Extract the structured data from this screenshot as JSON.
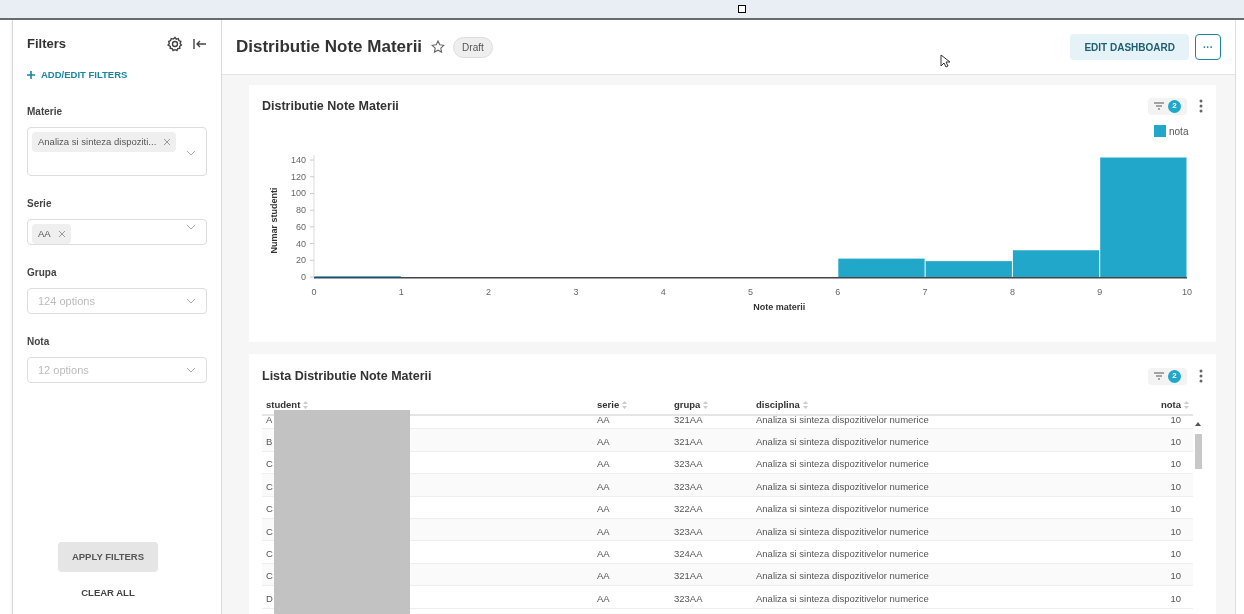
{
  "sidebar": {
    "title": "Filters",
    "add_filters": "ADD/EDIT FILTERS",
    "filters": [
      {
        "kind": "tags",
        "label": "Materie",
        "tags": [
          "Analiza si sinteza dispoziti..."
        ]
      },
      {
        "kind": "tags",
        "label": "Serie",
        "tags": [
          "AA"
        ]
      },
      {
        "kind": "empty",
        "label": "Grupa",
        "placeholder": "124 options"
      },
      {
        "kind": "empty",
        "label": "Nota",
        "placeholder": "12 options"
      }
    ],
    "apply_button": "APPLY FILTERS",
    "clear_button": "CLEAR ALL"
  },
  "header": {
    "title": "Distributie Note Materii",
    "starred": false,
    "badge": "Draft",
    "edit_button": "EDIT DASHBOARD",
    "more_button": "···"
  },
  "chart_card": {
    "title": "Distributie Note Materii",
    "filter_count": "2",
    "chart_data": {
      "type": "bar",
      "xlabel": "Note materii",
      "ylabel": "Numar studenti",
      "x": [
        0.5,
        6.5,
        7.5,
        8.5,
        9.5
      ],
      "series": [
        {
          "name": "nota",
          "color": "#20a7c9",
          "values": [
            1,
            22,
            19,
            32,
            143
          ]
        }
      ],
      "xlim": [
        0,
        10
      ],
      "ylim": [
        0,
        146
      ],
      "xticks": [
        0,
        1,
        2,
        3,
        4,
        5,
        6,
        7,
        8,
        9,
        10
      ],
      "yticks": [
        0,
        20,
        40,
        60,
        80,
        100,
        120,
        140
      ]
    }
  },
  "table_card": {
    "title": "Lista Distributie Note Materii",
    "filter_count": "2",
    "columns": [
      "student",
      "serie",
      "grupa",
      "disciplina",
      "nota"
    ],
    "rows": [
      [
        "A",
        "AA",
        "321AA",
        "Analiza si sinteza dispozitivelor numerice",
        "10"
      ],
      [
        "B",
        "AA",
        "321AA",
        "Analiza si sinteza dispozitivelor numerice",
        "10"
      ],
      [
        "C",
        "AA",
        "323AA",
        "Analiza si sinteza dispozitivelor numerice",
        "10"
      ],
      [
        "C",
        "AA",
        "323AA",
        "Analiza si sinteza dispozitivelor numerice",
        "10"
      ],
      [
        "C",
        "AA",
        "322AA",
        "Analiza si sinteza dispozitivelor numerice",
        "10"
      ],
      [
        "C",
        "AA",
        "323AA",
        "Analiza si sinteza dispozitivelor numerice",
        "10"
      ],
      [
        "C",
        "AA",
        "324AA",
        "Analiza si sinteza dispozitivelor numerice",
        "10"
      ],
      [
        "C",
        "AA",
        "321AA",
        "Analiza si sinteza dispozitivelor numerice",
        "10"
      ],
      [
        "D",
        "AA",
        "323AA",
        "Analiza si sinteza dispozitivelor numerice",
        "10"
      ]
    ]
  }
}
